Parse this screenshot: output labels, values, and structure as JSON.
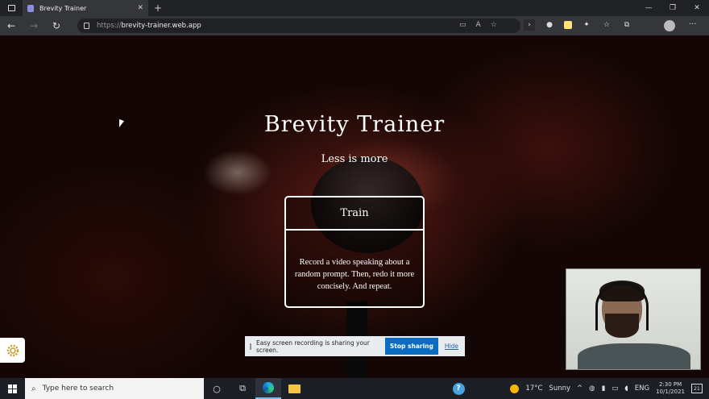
{
  "browser": {
    "tab_title": "Brevity Trainer",
    "tab_close": "✕",
    "new_tab": "+",
    "url_protocol": "https://",
    "url_host": "brevity-trainer.web.app",
    "minimize": "—",
    "restore": "❐",
    "close": "✕",
    "more": "···"
  },
  "page": {
    "title": "Brevity Trainer",
    "subtitle": "Less is more",
    "card": {
      "title": "Train",
      "description": "Record a video speaking about a random prompt. Then, redo it more concisely. And repeat."
    }
  },
  "screen_share": {
    "message": "Easy screen recording is sharing your screen.",
    "stop_label": "Stop sharing",
    "hide_label": "Hide"
  },
  "taskbar": {
    "search_placeholder": "Type here to search",
    "weather_temp": "17°C",
    "weather_desc": "Sunny",
    "language": "ENG",
    "time": "2:30 PM",
    "date": "10/1/2021",
    "notification_count": "21"
  }
}
